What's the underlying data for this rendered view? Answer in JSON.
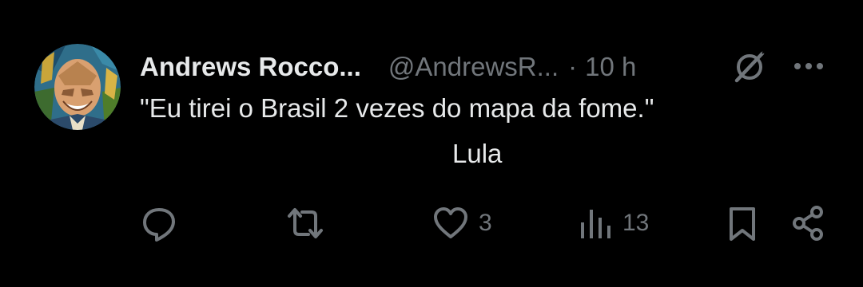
{
  "tweet": {
    "author": {
      "display_name": "Andrews Rocco...",
      "handle": "@AndrewsR...",
      "avatar_icon": "avatar-portrait"
    },
    "separator": "·",
    "timestamp": "10 h",
    "body": {
      "line1": "\"Eu tirei o Brasil 2 vezes do mapa da fome.\"",
      "line2": "Lula"
    },
    "header_icons": [
      "grok-icon",
      "more-icon"
    ],
    "actions": {
      "reply": {
        "icon": "reply-icon",
        "count": ""
      },
      "retweet": {
        "icon": "retweet-icon",
        "count": ""
      },
      "like": {
        "icon": "heart-icon",
        "count": "3"
      },
      "views": {
        "icon": "views-icon",
        "count": "13"
      },
      "bookmark": {
        "icon": "bookmark-icon",
        "count": ""
      },
      "share": {
        "icon": "share-icon",
        "count": ""
      }
    },
    "colors": {
      "background": "#000000",
      "primary_text": "#e7e9ea",
      "secondary_text": "#71767b"
    }
  }
}
